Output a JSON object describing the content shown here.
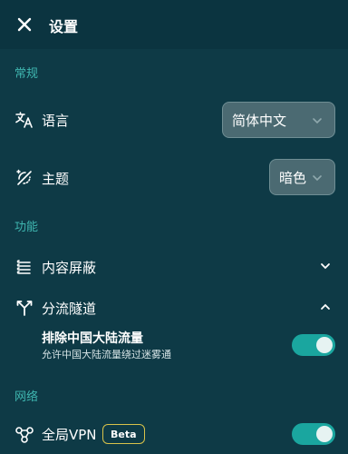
{
  "header": {
    "title": "设置"
  },
  "sections": {
    "general": "常规",
    "features": "功能",
    "network": "网络"
  },
  "language": {
    "label": "语言",
    "value": "简体中文"
  },
  "theme": {
    "label": "主题",
    "value": "暗色"
  },
  "content_block": {
    "label": "内容屏蔽"
  },
  "split_tunnel": {
    "label": "分流隧道",
    "exclude_title": "排除中国大陆流量",
    "exclude_desc": "允许中国大陆流量绕过迷雾通",
    "exclude_enabled": true
  },
  "global_vpn": {
    "label": "全局VPN",
    "badge": "Beta",
    "enabled": true
  },
  "colors": {
    "background": "#0e3a46",
    "header": "#0b3440",
    "accent": "#3fb6b0",
    "toggle": "#1aa69f",
    "badge_border": "#d8c24a"
  }
}
